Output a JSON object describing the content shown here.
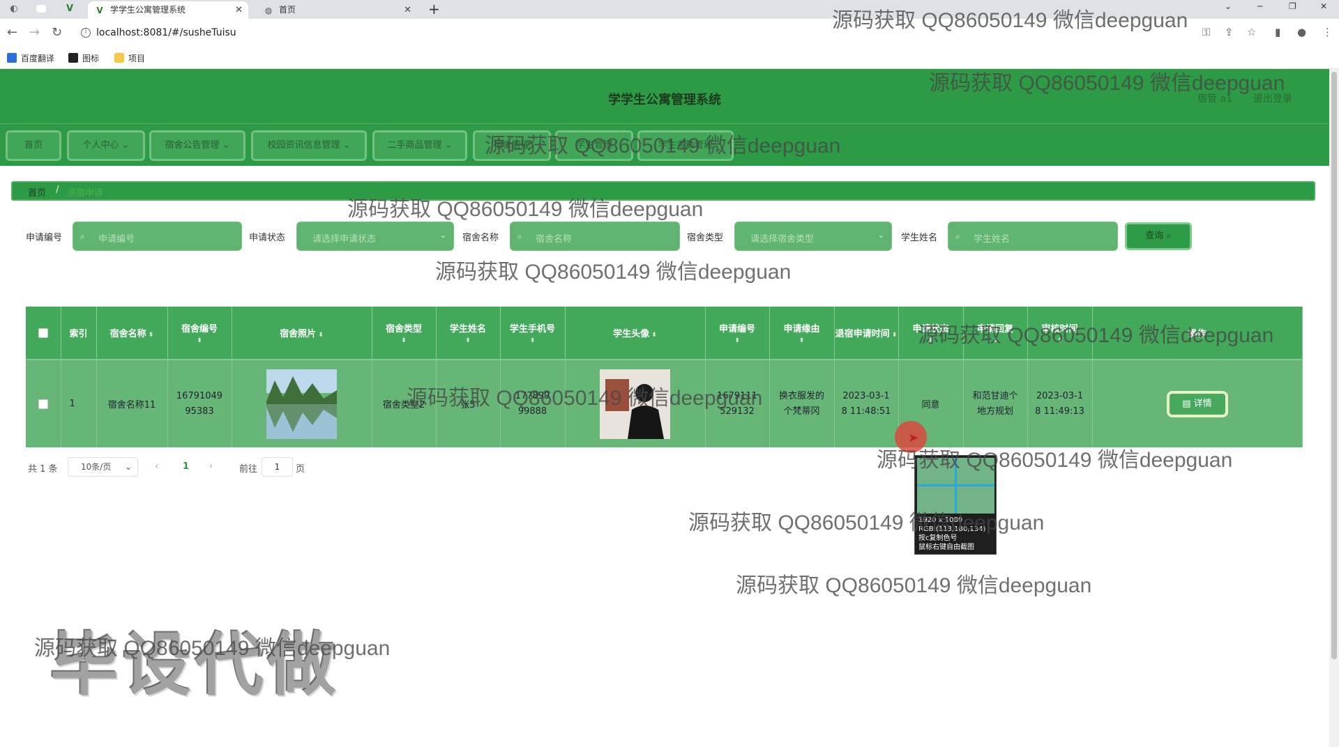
{
  "browser": {
    "tabs": [
      {
        "title": "学学生公寓管理系统",
        "active": true
      },
      {
        "title": "首页",
        "active": false
      }
    ],
    "url": "localhost:8081/#/susheTuisu",
    "bookmarks": [
      "百度翻译",
      "图标",
      "项目"
    ]
  },
  "app": {
    "title": "学学生公寓管理系统",
    "user_label": "宿管 a1",
    "logout_label": "退出登录",
    "menu": [
      "首页",
      "个人中心",
      "宿舍公告管理",
      "校园资讯信息管理",
      "二手商品管理",
      "宿舍管理",
      "学生管理",
      "学生考勤管理"
    ],
    "breadcrumb": {
      "home": "首页",
      "separator": "/",
      "current": "退宿申请"
    }
  },
  "filters": [
    {
      "label": "申请编号",
      "placeholder": "申请编号",
      "type": "input"
    },
    {
      "label": "申请状态",
      "placeholder": "请选择申请状态",
      "type": "select"
    },
    {
      "label": "宿舍名称",
      "placeholder": "宿舍名称",
      "type": "input"
    },
    {
      "label": "宿舍类型",
      "placeholder": "请选择宿舍类型",
      "type": "select"
    },
    {
      "label": "学生姓名",
      "placeholder": "学生姓名",
      "type": "input"
    }
  ],
  "search_button": "查询",
  "table": {
    "headers": [
      "索引",
      "宿舍名称",
      "宿舍编号",
      "宿舍照片",
      "宿舍类型",
      "学生姓名",
      "学生手机号",
      "学生头像",
      "申请编号",
      "申请缘由",
      "退宿申请时间",
      "申请状态",
      "申请回复",
      "审核时间",
      "操作"
    ],
    "rows": [
      {
        "index": "1",
        "dorm_name": "宿舍名称11",
        "dorm_number": "1679104995383",
        "dorm_type": "宿舍类型2",
        "student_name": "张5",
        "student_phone": "17789999888",
        "apply_number": "1679111529132",
        "reason": "换衣服发的个梵蒂冈",
        "apply_time": "2023-03-18 11:48:51",
        "status": "同意",
        "reply": "和范甘迪个地方规划",
        "review_time": "2023-03-18 11:49:13",
        "action": "详情"
      }
    ]
  },
  "pagination": {
    "total": "共 1 条",
    "page_size": "10条/页",
    "current_page": "1",
    "goto_prefix": "前往",
    "goto_value": "1",
    "goto_suffix": "页"
  },
  "color_picker": {
    "size": "1920 x 1080",
    "rgb": "RGB:(113,180,134)",
    "hint1": "按c复制色号",
    "hint2": "鼠标右键自由截图"
  },
  "watermark": {
    "text": "源码获取 QQ86050149 微信deepguan",
    "big_text": "毕设代做"
  },
  "colors": {
    "header_green": "#2d9a46",
    "table_header": "#42a95a",
    "table_row": "#66b677",
    "input_green": "#5fb56f"
  }
}
